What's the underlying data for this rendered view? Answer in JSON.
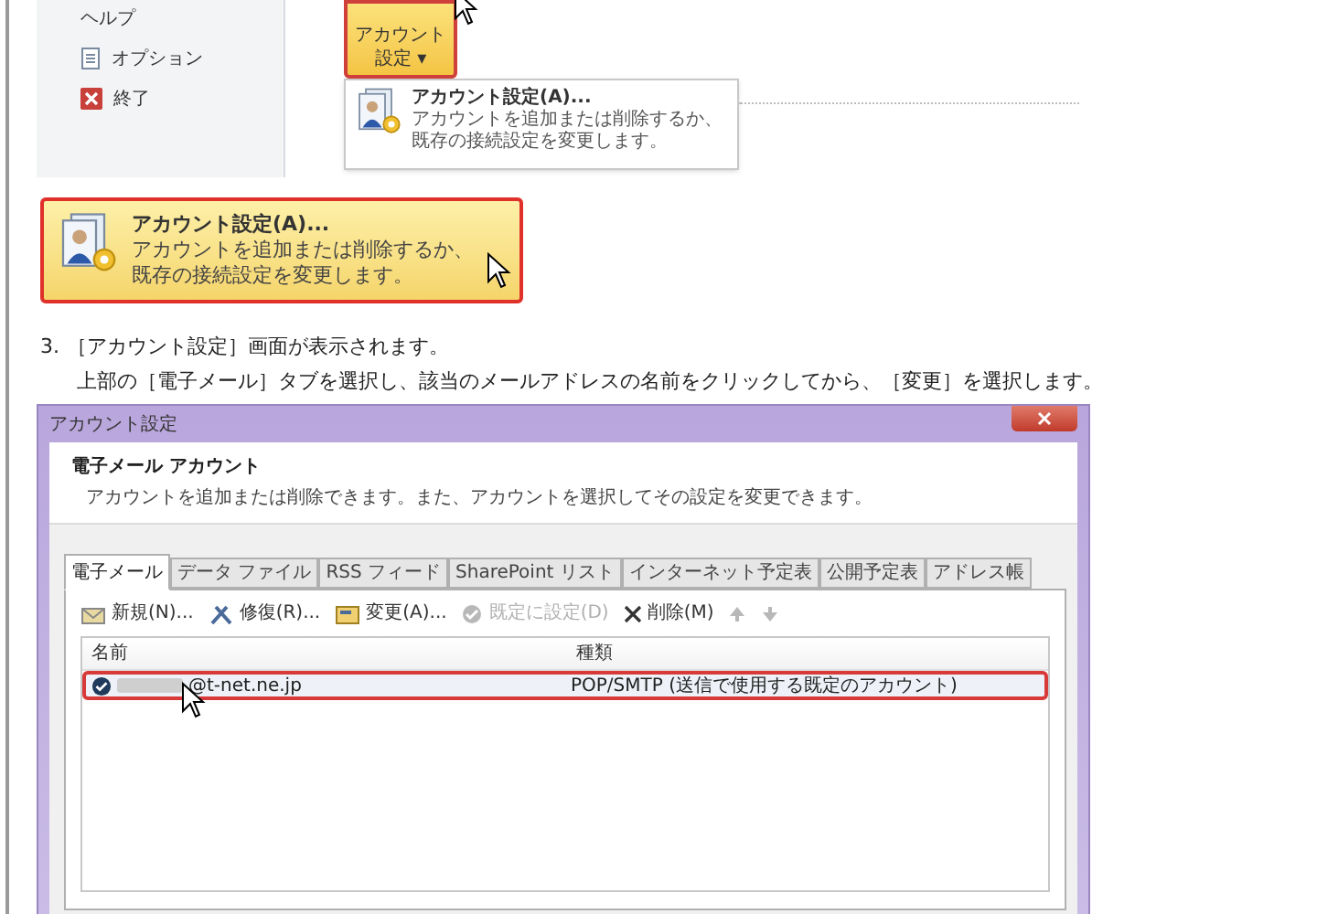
{
  "backstage": {
    "sidebar_items": [
      {
        "label": "ヘルプ",
        "kind": "none"
      },
      {
        "label": "オプション",
        "kind": "options"
      },
      {
        "label": "終了",
        "kind": "exit"
      }
    ],
    "account_button": {
      "lines": [
        "アカウント",
        "設定 ▾"
      ],
      "highlighted": true
    },
    "dropdown": {
      "title": "アカウント設定(A)...",
      "description": "アカウントを追加または削除するか、既存の接続設定を変更します。"
    }
  },
  "callout": {
    "title": "アカウント設定(A)...",
    "description": "アカウントを追加または削除するか、既存の接続設定を変更します。",
    "highlighted": true
  },
  "step": {
    "number": "3.",
    "title": "［アカウント設定］画面が表示されます。",
    "instruction": "上部の［電子メール］タブを選択し、該当のメールアドレスの名前をクリックしてから、［変更］を選択します。"
  },
  "dialog": {
    "title": "アカウント設定",
    "heading": "電子メール アカウント",
    "description": "アカウントを追加または削除できます。また、アカウントを選択してその設定を変更できます。",
    "tabs": [
      {
        "label": "電子メール",
        "selected": true
      },
      {
        "label": "データ ファイル",
        "selected": false
      },
      {
        "label": "RSS フィード",
        "selected": false
      },
      {
        "label": "SharePoint リスト",
        "selected": false
      },
      {
        "label": "インターネット予定表",
        "selected": false
      },
      {
        "label": "公開予定表",
        "selected": false
      },
      {
        "label": "アドレス帳",
        "selected": false
      }
    ],
    "toolbar": [
      {
        "kind": "new",
        "label": "新規(N)...",
        "disabled": false
      },
      {
        "kind": "repair",
        "label": "修復(R)...",
        "disabled": false
      },
      {
        "kind": "change",
        "label": "変更(A)...",
        "disabled": false
      },
      {
        "kind": "default",
        "label": "既定に設定(D)",
        "disabled": true
      },
      {
        "kind": "delete",
        "label": "削除(M)",
        "disabled": false
      },
      {
        "kind": "up",
        "disabled": true
      },
      {
        "kind": "down",
        "disabled": true
      }
    ],
    "columns": [
      "名前",
      "種類"
    ],
    "rows": [
      {
        "name": "@t-net.ne.jp",
        "type": "POP/SMTP (送信で使用する既定のアカウント)",
        "default": true,
        "selected": true
      }
    ]
  }
}
